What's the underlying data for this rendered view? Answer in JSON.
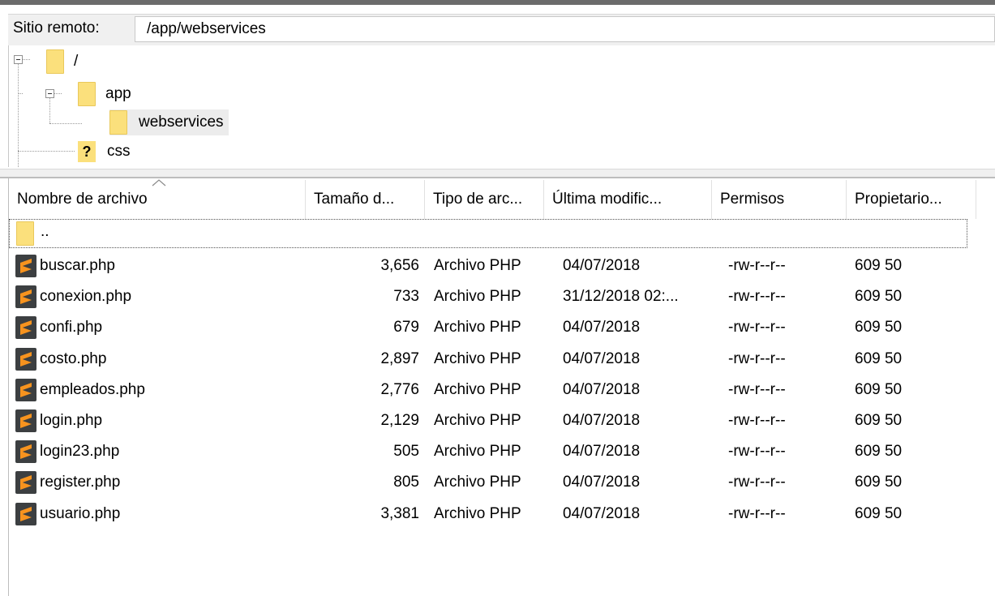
{
  "remote": {
    "label": "Sitio remoto:",
    "path": "/app/webservices"
  },
  "tree": {
    "root": "/",
    "app": "app",
    "webservices": "webservices",
    "css": "css",
    "unknown_marker": "?"
  },
  "columns": {
    "name": "Nombre de archivo",
    "size": "Tamaño d...",
    "type": "Tipo de arc...",
    "modified": "Última modific...",
    "perms": "Permisos",
    "owner": "Propietario..."
  },
  "parent_dir": "..",
  "files": [
    {
      "name": "buscar.php",
      "size": "3,656",
      "type": "Archivo PHP",
      "modified": "04/07/2018",
      "perms": "-rw-r--r--",
      "owner": "609 50"
    },
    {
      "name": "conexion.php",
      "size": "733",
      "type": "Archivo PHP",
      "modified": "31/12/2018 02:...",
      "perms": "-rw-r--r--",
      "owner": "609 50"
    },
    {
      "name": "confi.php",
      "size": "679",
      "type": "Archivo PHP",
      "modified": "04/07/2018",
      "perms": "-rw-r--r--",
      "owner": "609 50"
    },
    {
      "name": "costo.php",
      "size": "2,897",
      "type": "Archivo PHP",
      "modified": "04/07/2018",
      "perms": "-rw-r--r--",
      "owner": "609 50"
    },
    {
      "name": "empleados.php",
      "size": "2,776",
      "type": "Archivo PHP",
      "modified": "04/07/2018",
      "perms": "-rw-r--r--",
      "owner": "609 50"
    },
    {
      "name": "login.php",
      "size": "2,129",
      "type": "Archivo PHP",
      "modified": "04/07/2018",
      "perms": "-rw-r--r--",
      "owner": "609 50"
    },
    {
      "name": "login23.php",
      "size": "505",
      "type": "Archivo PHP",
      "modified": "04/07/2018",
      "perms": "-rw-r--r--",
      "owner": "609 50"
    },
    {
      "name": "register.php",
      "size": "805",
      "type": "Archivo PHP",
      "modified": "04/07/2018",
      "perms": "-rw-r--r--",
      "owner": "609 50"
    },
    {
      "name": "usuario.php",
      "size": "3,381",
      "type": "Archivo PHP",
      "modified": "04/07/2018",
      "perms": "-rw-r--r--",
      "owner": "609 50"
    }
  ],
  "colors": {
    "folder": "#fbe07c",
    "php_icon_bg": "#3c3f41",
    "php_icon_fg": "#f7931e",
    "selection": "#ececec"
  },
  "icons": {
    "folder": "folder-icon",
    "php": "sublime-php-icon",
    "unknown": "unknown-folder-icon",
    "sort": "sort-ascending-icon",
    "collapse": "collapse-icon"
  }
}
